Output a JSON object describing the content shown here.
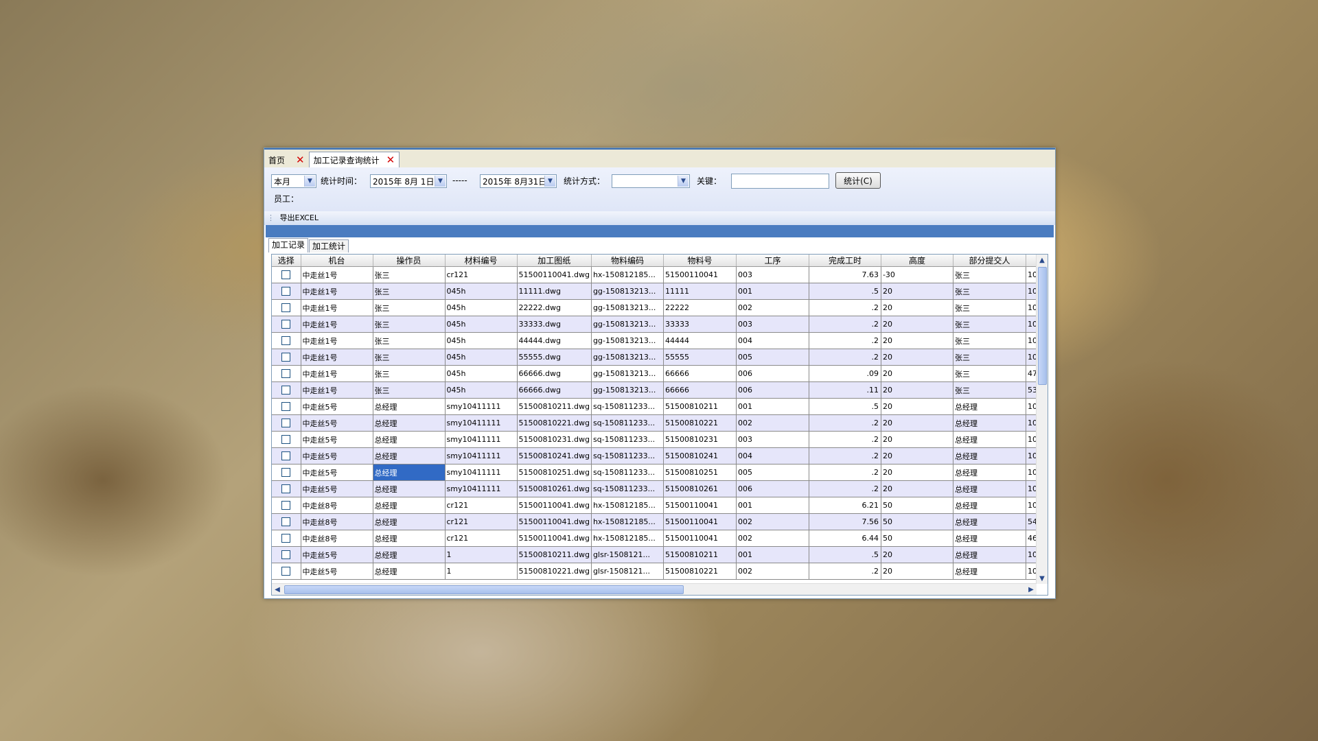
{
  "doc_tabs": [
    {
      "label": "首页"
    },
    {
      "label": "加工记录查询统计"
    }
  ],
  "filters": {
    "period": "本月",
    "time_label": "统计时间：",
    "date_from": "2015年 8月 1日",
    "separator": "-----",
    "date_to": "2015年 8月31日",
    "method_label": "统计方式：",
    "method_value": "",
    "keyword_label": "关键：",
    "keyword_value": "",
    "stat_button": "统计(C)",
    "employee_label": "员工："
  },
  "toolbar": {
    "export_label": "导出EXCEL"
  },
  "inner_tabs": [
    "加工记录",
    "加工统计"
  ],
  "table": {
    "columns": [
      "选择",
      "机台",
      "操作员",
      "材料编号",
      "加工图纸",
      "物料编码",
      "物料号",
      "工序",
      "完成工时",
      "高度",
      "部分提交人",
      ""
    ],
    "rows": [
      [
        "中走丝1号",
        "张三",
        "cr121",
        "51500110041.dwg",
        "hx-150812185...",
        "51500110041",
        "003",
        "7.63",
        "-30",
        "张三",
        "10"
      ],
      [
        "中走丝1号",
        "张三",
        "045h",
        "11111.dwg",
        "gg-150813213...",
        "11111",
        "001",
        ".5",
        "20",
        "张三",
        "10"
      ],
      [
        "中走丝1号",
        "张三",
        "045h",
        "22222.dwg",
        "gg-150813213...",
        "22222",
        "002",
        ".2",
        "20",
        "张三",
        "10"
      ],
      [
        "中走丝1号",
        "张三",
        "045h",
        "33333.dwg",
        "gg-150813213...",
        "33333",
        "003",
        ".2",
        "20",
        "张三",
        "10"
      ],
      [
        "中走丝1号",
        "张三",
        "045h",
        "44444.dwg",
        "gg-150813213...",
        "44444",
        "004",
        ".2",
        "20",
        "张三",
        "10"
      ],
      [
        "中走丝1号",
        "张三",
        "045h",
        "55555.dwg",
        "gg-150813213...",
        "55555",
        "005",
        ".2",
        "20",
        "张三",
        "10"
      ],
      [
        "中走丝1号",
        "张三",
        "045h",
        "66666.dwg",
        "gg-150813213...",
        "66666",
        "006",
        ".09",
        "20",
        "张三",
        "47"
      ],
      [
        "中走丝1号",
        "张三",
        "045h",
        "66666.dwg",
        "gg-150813213...",
        "66666",
        "006",
        ".11",
        "20",
        "张三",
        "53"
      ],
      [
        "中走丝5号",
        "总经理",
        "smy10411111",
        "51500810211.dwg",
        "sq-150811233...",
        "51500810211",
        "001",
        ".5",
        "20",
        "总经理",
        "10"
      ],
      [
        "中走丝5号",
        "总经理",
        "smy10411111",
        "51500810221.dwg",
        "sq-150811233...",
        "51500810221",
        "002",
        ".2",
        "20",
        "总经理",
        "10"
      ],
      [
        "中走丝5号",
        "总经理",
        "smy10411111",
        "51500810231.dwg",
        "sq-150811233...",
        "51500810231",
        "003",
        ".2",
        "20",
        "总经理",
        "10"
      ],
      [
        "中走丝5号",
        "总经理",
        "smy10411111",
        "51500810241.dwg",
        "sq-150811233...",
        "51500810241",
        "004",
        ".2",
        "20",
        "总经理",
        "10"
      ],
      [
        "中走丝5号",
        "总经理",
        "smy10411111",
        "51500810251.dwg",
        "sq-150811233...",
        "51500810251",
        "005",
        ".2",
        "20",
        "总经理",
        "10"
      ],
      [
        "中走丝5号",
        "总经理",
        "smy10411111",
        "51500810261.dwg",
        "sq-150811233...",
        "51500810261",
        "006",
        ".2",
        "20",
        "总经理",
        "10"
      ],
      [
        "中走丝8号",
        "总经理",
        "cr121",
        "51500110041.dwg",
        "hx-150812185...",
        "51500110041",
        "001",
        "6.21",
        "50",
        "总经理",
        "10"
      ],
      [
        "中走丝8号",
        "总经理",
        "cr121",
        "51500110041.dwg",
        "hx-150812185...",
        "51500110041",
        "002",
        "7.56",
        "50",
        "总经理",
        "54"
      ],
      [
        "中走丝8号",
        "总经理",
        "cr121",
        "51500110041.dwg",
        "hx-150812185...",
        "51500110041",
        "002",
        "6.44",
        "50",
        "总经理",
        "46"
      ],
      [
        "中走丝5号",
        "总经理",
        "1",
        "51500810211.dwg",
        "glsr-1508121...",
        "51500810211",
        "001",
        ".5",
        "20",
        "总经理",
        "10"
      ],
      [
        "中走丝5号",
        "总经理",
        "1",
        "51500810221.dwg",
        "glsr-1508121...",
        "51500810221",
        "002",
        ".2",
        "20",
        "总经理",
        "10"
      ]
    ],
    "selected_cell": {
      "row": 12,
      "col": 1
    }
  }
}
